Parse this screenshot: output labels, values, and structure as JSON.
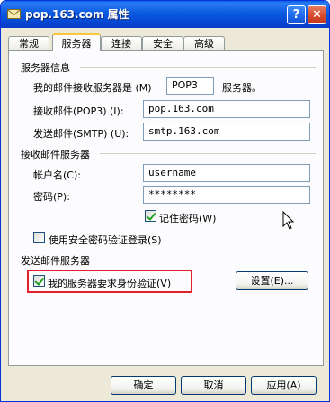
{
  "window": {
    "title": "pop.163.com 属性",
    "help_glyph": "?",
    "close_glyph": "✕"
  },
  "tabs": [
    "常规",
    "服务器",
    "连接",
    "安全",
    "高级"
  ],
  "active_tab_index": 1,
  "server_info": {
    "section_label": "服务器信息",
    "incoming_type_prefix": "我的邮件接收服务器是 (M)",
    "incoming_type_value": "POP3",
    "incoming_type_suffix": "服务器。",
    "incoming_label": "接收邮件(POP3) (I):",
    "incoming_value": "pop.163.com",
    "outgoing_label": "发送邮件(SMTP) (U):",
    "outgoing_value": "smtp.163.com"
  },
  "incoming_server": {
    "section_label": "接收邮件服务器",
    "account_label": "帐户名(C):",
    "account_value": "username",
    "password_label": "密码(P):",
    "password_value": "********",
    "remember_label": "记住密码(W)",
    "remember_checked": true,
    "spa_label": "使用安全密码验证登录(S)",
    "spa_checked": false
  },
  "outgoing_server": {
    "section_label": "发送邮件服务器",
    "auth_label": "我的服务器要求身份验证(V)",
    "auth_checked": true,
    "settings_button": "设置(E)..."
  },
  "footer": {
    "ok": "确定",
    "cancel": "取消",
    "apply": "应用(A)"
  },
  "colors": {
    "title_bar": "#0a5fe6",
    "highlight_border": "#e0202a",
    "checkmark": "#21a121"
  }
}
